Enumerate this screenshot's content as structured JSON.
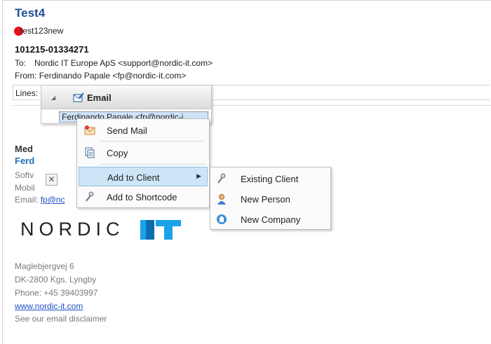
{
  "message": {
    "title": "Test4",
    "category": {
      "label": "test123new",
      "color": "#e8101a"
    },
    "case_number": "101215-01334271",
    "to_label": "To:",
    "to_value": "Nordic IT Europe ApS <support@nordic-it.com>",
    "from_label": "From:",
    "from_value": "Ferdinando Papale <fp@nordic-it.com>",
    "lines_label": "Lines:"
  },
  "signature": {
    "line1": "Med",
    "line2": "Ferd",
    "line3": "Softv",
    "line4": "Mobil",
    "email_label": "Email:",
    "email_link": "fp@nc",
    "logo_text": "NORDIC",
    "address1": "Maglebjergvej 6",
    "address2": "DK-2800 Kgs. Lyngby",
    "phone": "Phone: +45 39403997",
    "website": "www.nordic-it.com",
    "disclaimer": "See our email disclaimer"
  },
  "close_glyph": "✕",
  "email_panel": {
    "arrow": "◢",
    "title": "Email",
    "row": "Ferdinando Papale <fp@nordic-i"
  },
  "context_menu": {
    "items": [
      {
        "label": "Send Mail",
        "icon": "send-mail-icon"
      },
      {
        "label": "Copy",
        "icon": "copy-icon"
      },
      {
        "label": "Add to Client",
        "icon": "none",
        "submenu_arrow": "▶"
      },
      {
        "label": "Add to Shortcode",
        "icon": "shortcode-icon"
      }
    ]
  },
  "submenu": {
    "items": [
      {
        "label": "Existing Client",
        "icon": "existing-client-icon"
      },
      {
        "label": "New Person",
        "icon": "new-person-icon"
      },
      {
        "label": "New Company",
        "icon": "new-company-icon"
      }
    ]
  },
  "colors": {
    "accent": "#1f4e96",
    "highlight": "#cde6f7",
    "logo_blue": "#1aa3e8"
  }
}
